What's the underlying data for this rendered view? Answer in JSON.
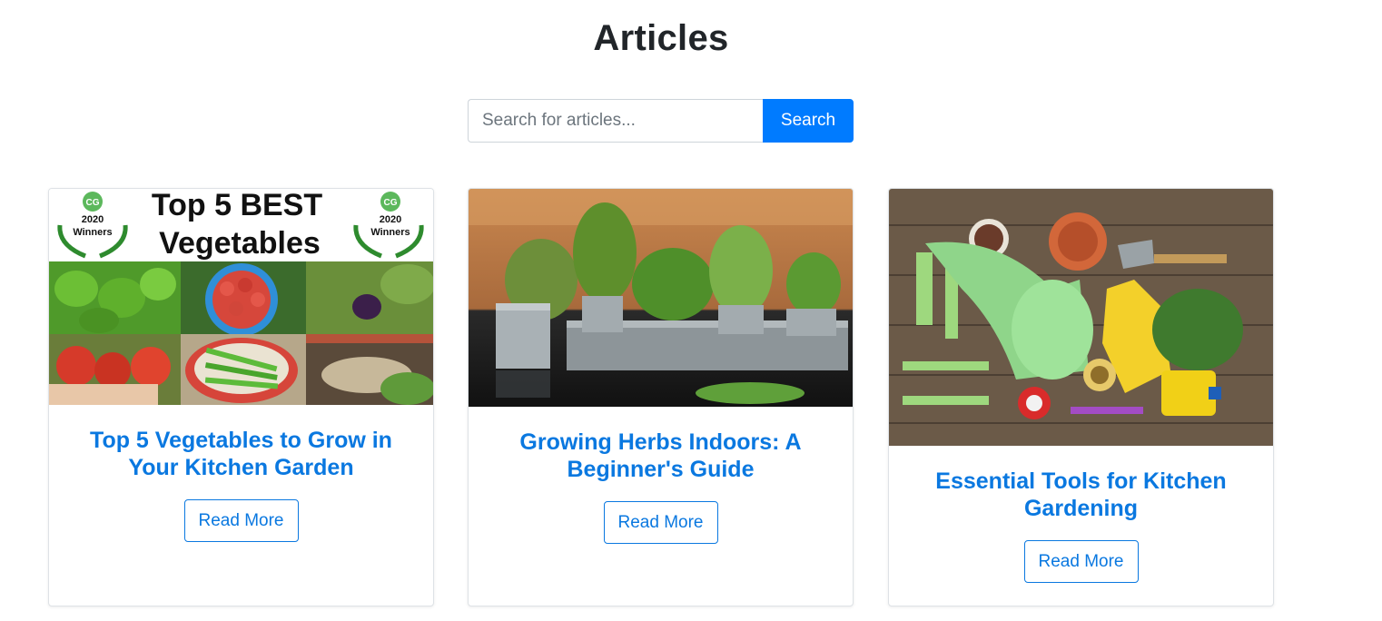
{
  "page": {
    "title": "Articles"
  },
  "search": {
    "placeholder": "Search for articles...",
    "button_label": "Search"
  },
  "articles": [
    {
      "title": "Top 5 Vegetables to Grow in Your Kitchen Garden",
      "button_label": "Read More",
      "image": {
        "banner_line1": "Top 5 BEST",
        "banner_line2": "Vegetables",
        "badge_logo": "CG",
        "badge_year": "2020",
        "badge_label": "Winners"
      }
    },
    {
      "title": "Growing Herbs Indoors: A Beginner's Guide",
      "button_label": "Read More"
    },
    {
      "title": "Essential Tools for Kitchen Gardening",
      "button_label": "Read More"
    }
  ],
  "colors": {
    "primary": "#007bff",
    "link": "#0a78e0",
    "border": "#dee2e6"
  }
}
